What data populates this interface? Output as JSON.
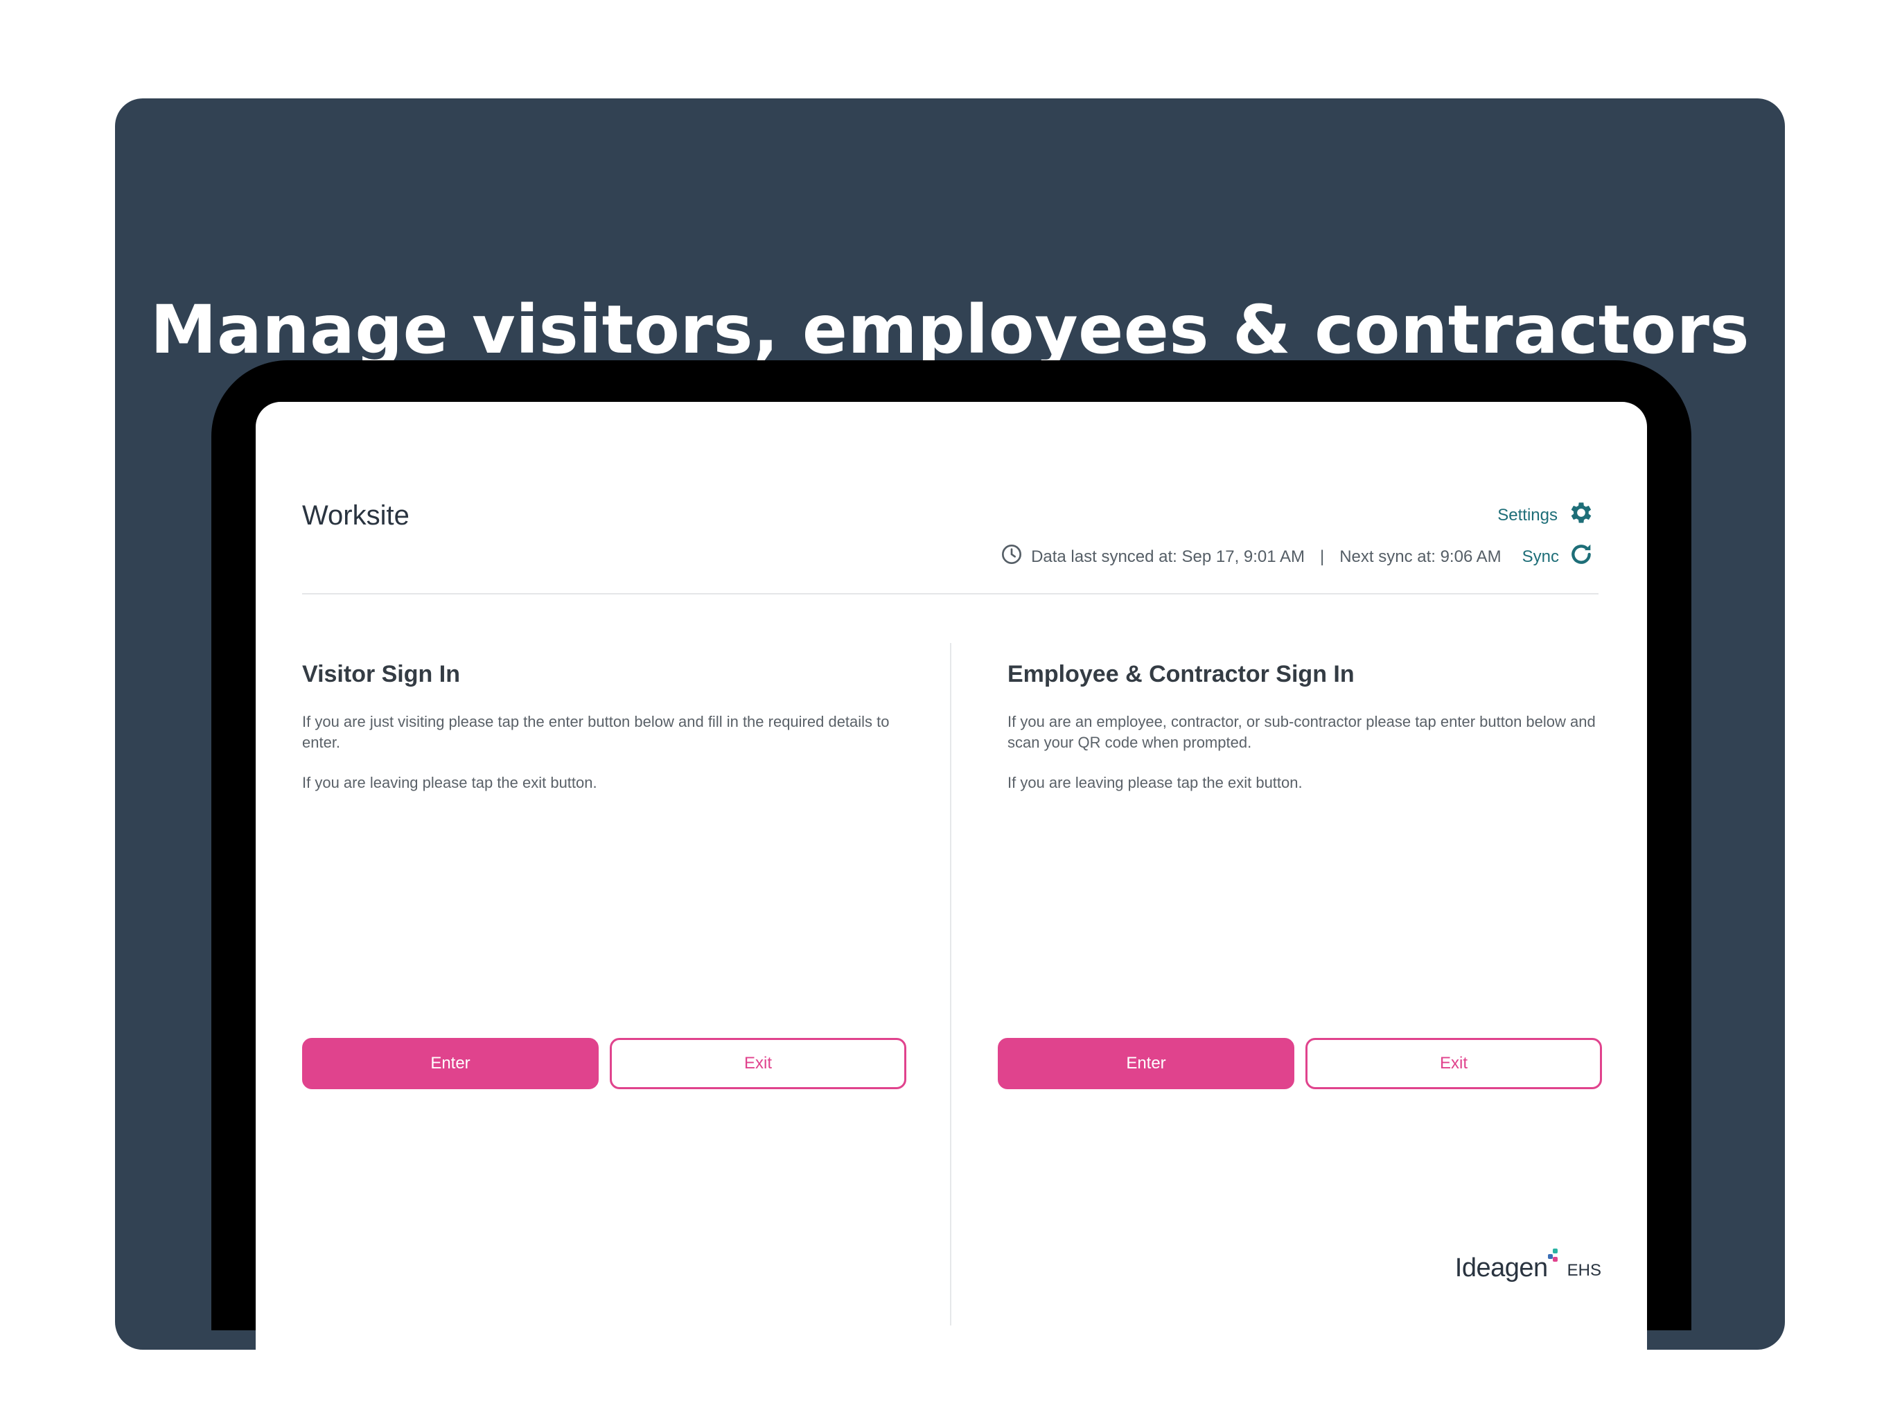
{
  "banner": {
    "headline": "Manage visitors, employees & contractors"
  },
  "app": {
    "site_name": "Worksite",
    "settings_label": "Settings",
    "sync_status": {
      "last_synced": "Data last synced at: Sep 17, 9:01 AM",
      "separator": "|",
      "next_sync": "Next sync at: 9:06 AM"
    },
    "sync_label": "Sync"
  },
  "visitor": {
    "title": "Visitor Sign In",
    "description_1": "If you are just visiting please tap the enter button below and fill in the required details to enter.",
    "description_2": "If you are leaving please tap the exit button.",
    "enter_label": "Enter",
    "exit_label": "Exit"
  },
  "employee": {
    "title": "Employee & Contractor Sign In",
    "description_1": "If you are an employee, contractor, or sub-contractor please tap enter button below and scan your QR code when prompted.",
    "description_2": "If you are leaving please tap the exit button.",
    "enter_label": "Enter",
    "exit_label": "Exit"
  },
  "logo": {
    "brand": "Ideagen",
    "suffix": "EHS"
  },
  "colors": {
    "banner_bg": "#324253",
    "accent_pink": "#e0438d",
    "accent_teal": "#1e6e78"
  },
  "icons": {
    "settings": "gear-icon",
    "clock": "clock-icon",
    "sync": "refresh-icon"
  }
}
